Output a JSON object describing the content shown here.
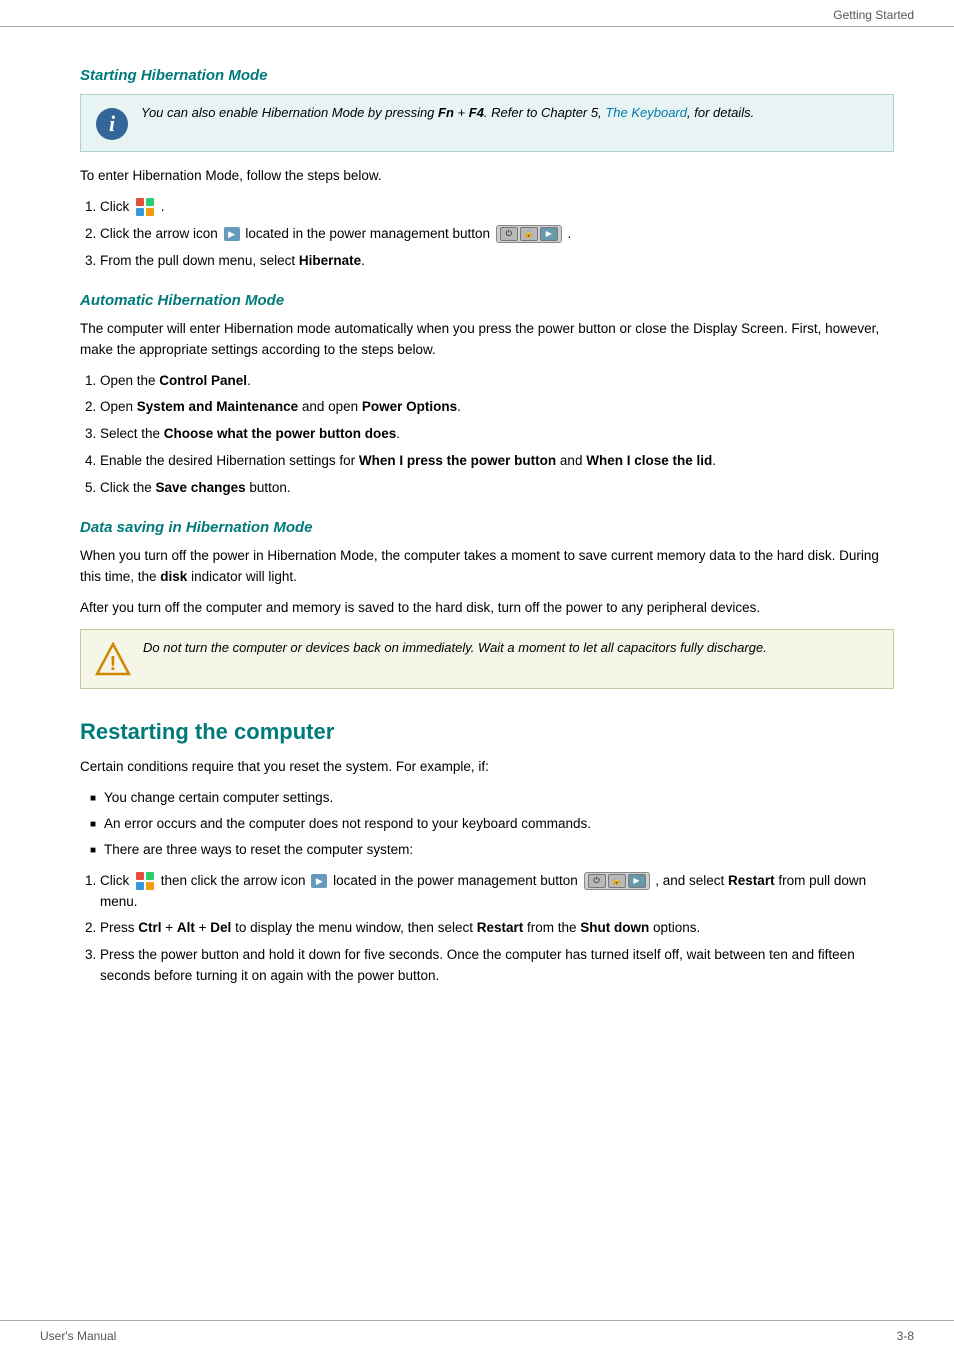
{
  "header": {
    "right_label": "Getting Started"
  },
  "footer": {
    "left_label": "User's Manual",
    "right_label": "3-8"
  },
  "starting_hibernation": {
    "title": "Starting Hibernation Mode",
    "info_note": "You can also enable Hibernation Mode by pressing ",
    "info_bold1": "Fn",
    "info_plus1": " + ",
    "info_bold2": "F4",
    "info_suffix": ". Refer to Chapter 5, ",
    "info_link": "The Keyboard",
    "info_end": ", for details.",
    "intro": "To enter Hibernation Mode, follow the steps below.",
    "steps": [
      "Click [Windows button].",
      "Click the arrow icon [▶] located in the power management button [PM strip].",
      "From the pull down menu, select Hibernate."
    ],
    "step1_pre": "Click",
    "step2_pre": "Click the arrow icon",
    "step2_mid": "located in the power management button",
    "step3_pre": "From the pull down menu, select",
    "step3_bold": "Hibernate",
    "step3_end": "."
  },
  "automatic_hibernation": {
    "title": "Automatic Hibernation Mode",
    "para": "The computer will enter Hibernation mode automatically when you press the power button or close the Display Screen. First, however, make the appropriate settings according to the steps below.",
    "steps": [
      {
        "pre": "Open the ",
        "bold": "Control Panel",
        "end": "."
      },
      {
        "pre": "Open ",
        "bold": "System and Maintenance",
        "mid": " and open ",
        "bold2": "Power Options",
        "end": "."
      },
      {
        "pre": "Select the ",
        "bold": "Choose what the power button does",
        "end": "."
      },
      {
        "pre": "Enable the desired Hibernation settings for ",
        "bold": "When I press the power button",
        "mid": " and ",
        "bold2": "When I close the lid",
        "end": "."
      },
      {
        "pre": "Click the ",
        "bold": "Save changes",
        "mid": " button.",
        "end": ""
      }
    ]
  },
  "data_saving": {
    "title": "Data saving in Hibernation Mode",
    "para1_pre": "When you turn off the power in Hibernation Mode, the computer takes a moment to save current memory data to the hard disk. During this time, the ",
    "para1_bold": "disk",
    "para1_end": " indicator will light.",
    "para2": "After you turn off the computer and memory is saved to the hard disk, turn off the power to any peripheral devices.",
    "warning": "Do not turn the computer or devices back on immediately. Wait a moment to let all capacitors fully discharge."
  },
  "restarting": {
    "title": "Restarting the computer",
    "intro": "Certain conditions require that you reset the system. For example, if:",
    "bullets": [
      "You change certain computer settings.",
      "An error occurs and the computer does not respond to your keyboard commands.",
      "There are three ways to reset the computer system:"
    ],
    "steps": [
      {
        "pre": "Click",
        "mid1": "then click the arrow icon",
        "mid2": "located in the power management button",
        "mid3": ", and select",
        "bold": "Restart",
        "end": "from pull down menu."
      },
      {
        "pre": "Press",
        "bold1": "Ctrl",
        "plus1": " + ",
        "bold2": "Alt",
        "plus2": " + ",
        "bold3": "Del",
        "mid": "to display the menu window, then select",
        "bold4": "Restart",
        "end": "from the",
        "bold5": "Shut down",
        "end2": "options."
      },
      {
        "text": "Press the power button and hold it down for five seconds. Once the computer has turned itself off, wait between ten and fifteen seconds before turning it on again with the power button."
      }
    ]
  }
}
